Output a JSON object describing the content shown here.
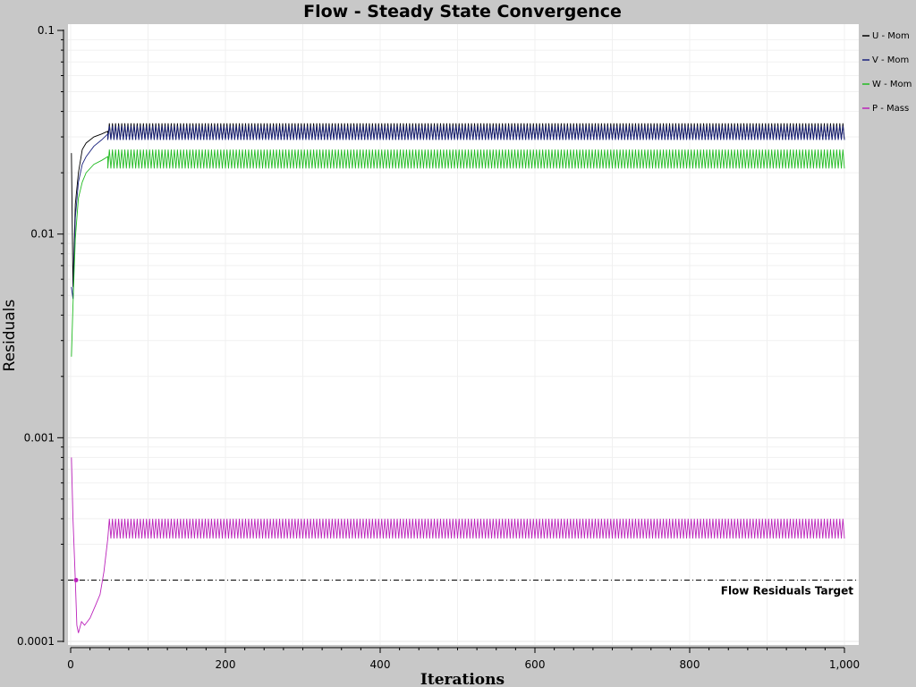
{
  "chart_data": {
    "type": "line",
    "title": "Flow - Steady State Convergence",
    "xlabel": "Iterations",
    "ylabel": "Residuals",
    "xlim": [
      0,
      1000
    ],
    "ylim": [
      0.0001,
      0.1
    ],
    "yscale": "log",
    "x_ticks": [
      0,
      200,
      400,
      600,
      800,
      1000
    ],
    "x_tick_labels": [
      "0",
      "200",
      "400",
      "600",
      "800",
      "1,000"
    ],
    "y_ticks": [
      0.1,
      0.01,
      0.001,
      0.0001
    ],
    "y_tick_labels": [
      "0.1",
      "0.01",
      "0.001",
      "0.0001"
    ],
    "grid": true,
    "legend_position": "right",
    "series": [
      {
        "name": "U - Mom",
        "color": "#000000",
        "initial": [
          [
            1,
            0.025
          ],
          [
            3,
            0.0055
          ],
          [
            6,
            0.014
          ],
          [
            10,
            0.02
          ],
          [
            15,
            0.026
          ],
          [
            20,
            0.028
          ],
          [
            30,
            0.03
          ],
          [
            40,
            0.031
          ],
          [
            48,
            0.032
          ]
        ],
        "oscillation": {
          "from": 48,
          "to": 1000,
          "period": 4,
          "low": 0.029,
          "high": 0.035
        }
      },
      {
        "name": "V - Mom",
        "color": "#1a237e",
        "initial": [
          [
            1,
            0.0055
          ],
          [
            3,
            0.0048
          ],
          [
            6,
            0.012
          ],
          [
            10,
            0.018
          ],
          [
            15,
            0.022
          ],
          [
            20,
            0.024
          ],
          [
            30,
            0.027
          ],
          [
            40,
            0.029
          ],
          [
            48,
            0.031
          ]
        ],
        "oscillation": {
          "from": 48,
          "to": 1000,
          "period": 4,
          "low": 0.029,
          "high": 0.034
        }
      },
      {
        "name": "W - Mom",
        "color": "#22bb22",
        "initial": [
          [
            1,
            0.0025
          ],
          [
            3,
            0.0045
          ],
          [
            6,
            0.0095
          ],
          [
            10,
            0.015
          ],
          [
            15,
            0.018
          ],
          [
            20,
            0.02
          ],
          [
            30,
            0.022
          ],
          [
            40,
            0.023
          ],
          [
            48,
            0.024
          ]
        ],
        "oscillation": {
          "from": 48,
          "to": 1000,
          "period": 4,
          "low": 0.021,
          "high": 0.026
        }
      },
      {
        "name": "P - Mass",
        "color": "#bb22bb",
        "initial": [
          [
            1,
            0.0008
          ],
          [
            3,
            0.0004
          ],
          [
            6,
            0.0002
          ],
          [
            8,
            0.00012
          ],
          [
            10,
            0.00011
          ],
          [
            14,
            0.000125
          ],
          [
            18,
            0.00012
          ],
          [
            25,
            0.00013
          ],
          [
            32,
            0.00015
          ],
          [
            38,
            0.00017
          ],
          [
            43,
            0.00022
          ],
          [
            48,
            0.00032
          ]
        ],
        "oscillation": {
          "from": 48,
          "to": 1000,
          "period": 4,
          "low": 0.00032,
          "high": 0.0004
        }
      }
    ],
    "target": {
      "label": "Flow Residuals Target",
      "value": 0.0002,
      "color": "#000000"
    },
    "marker": {
      "x": 7,
      "y": 0.0002,
      "color": "#bb22bb"
    }
  }
}
